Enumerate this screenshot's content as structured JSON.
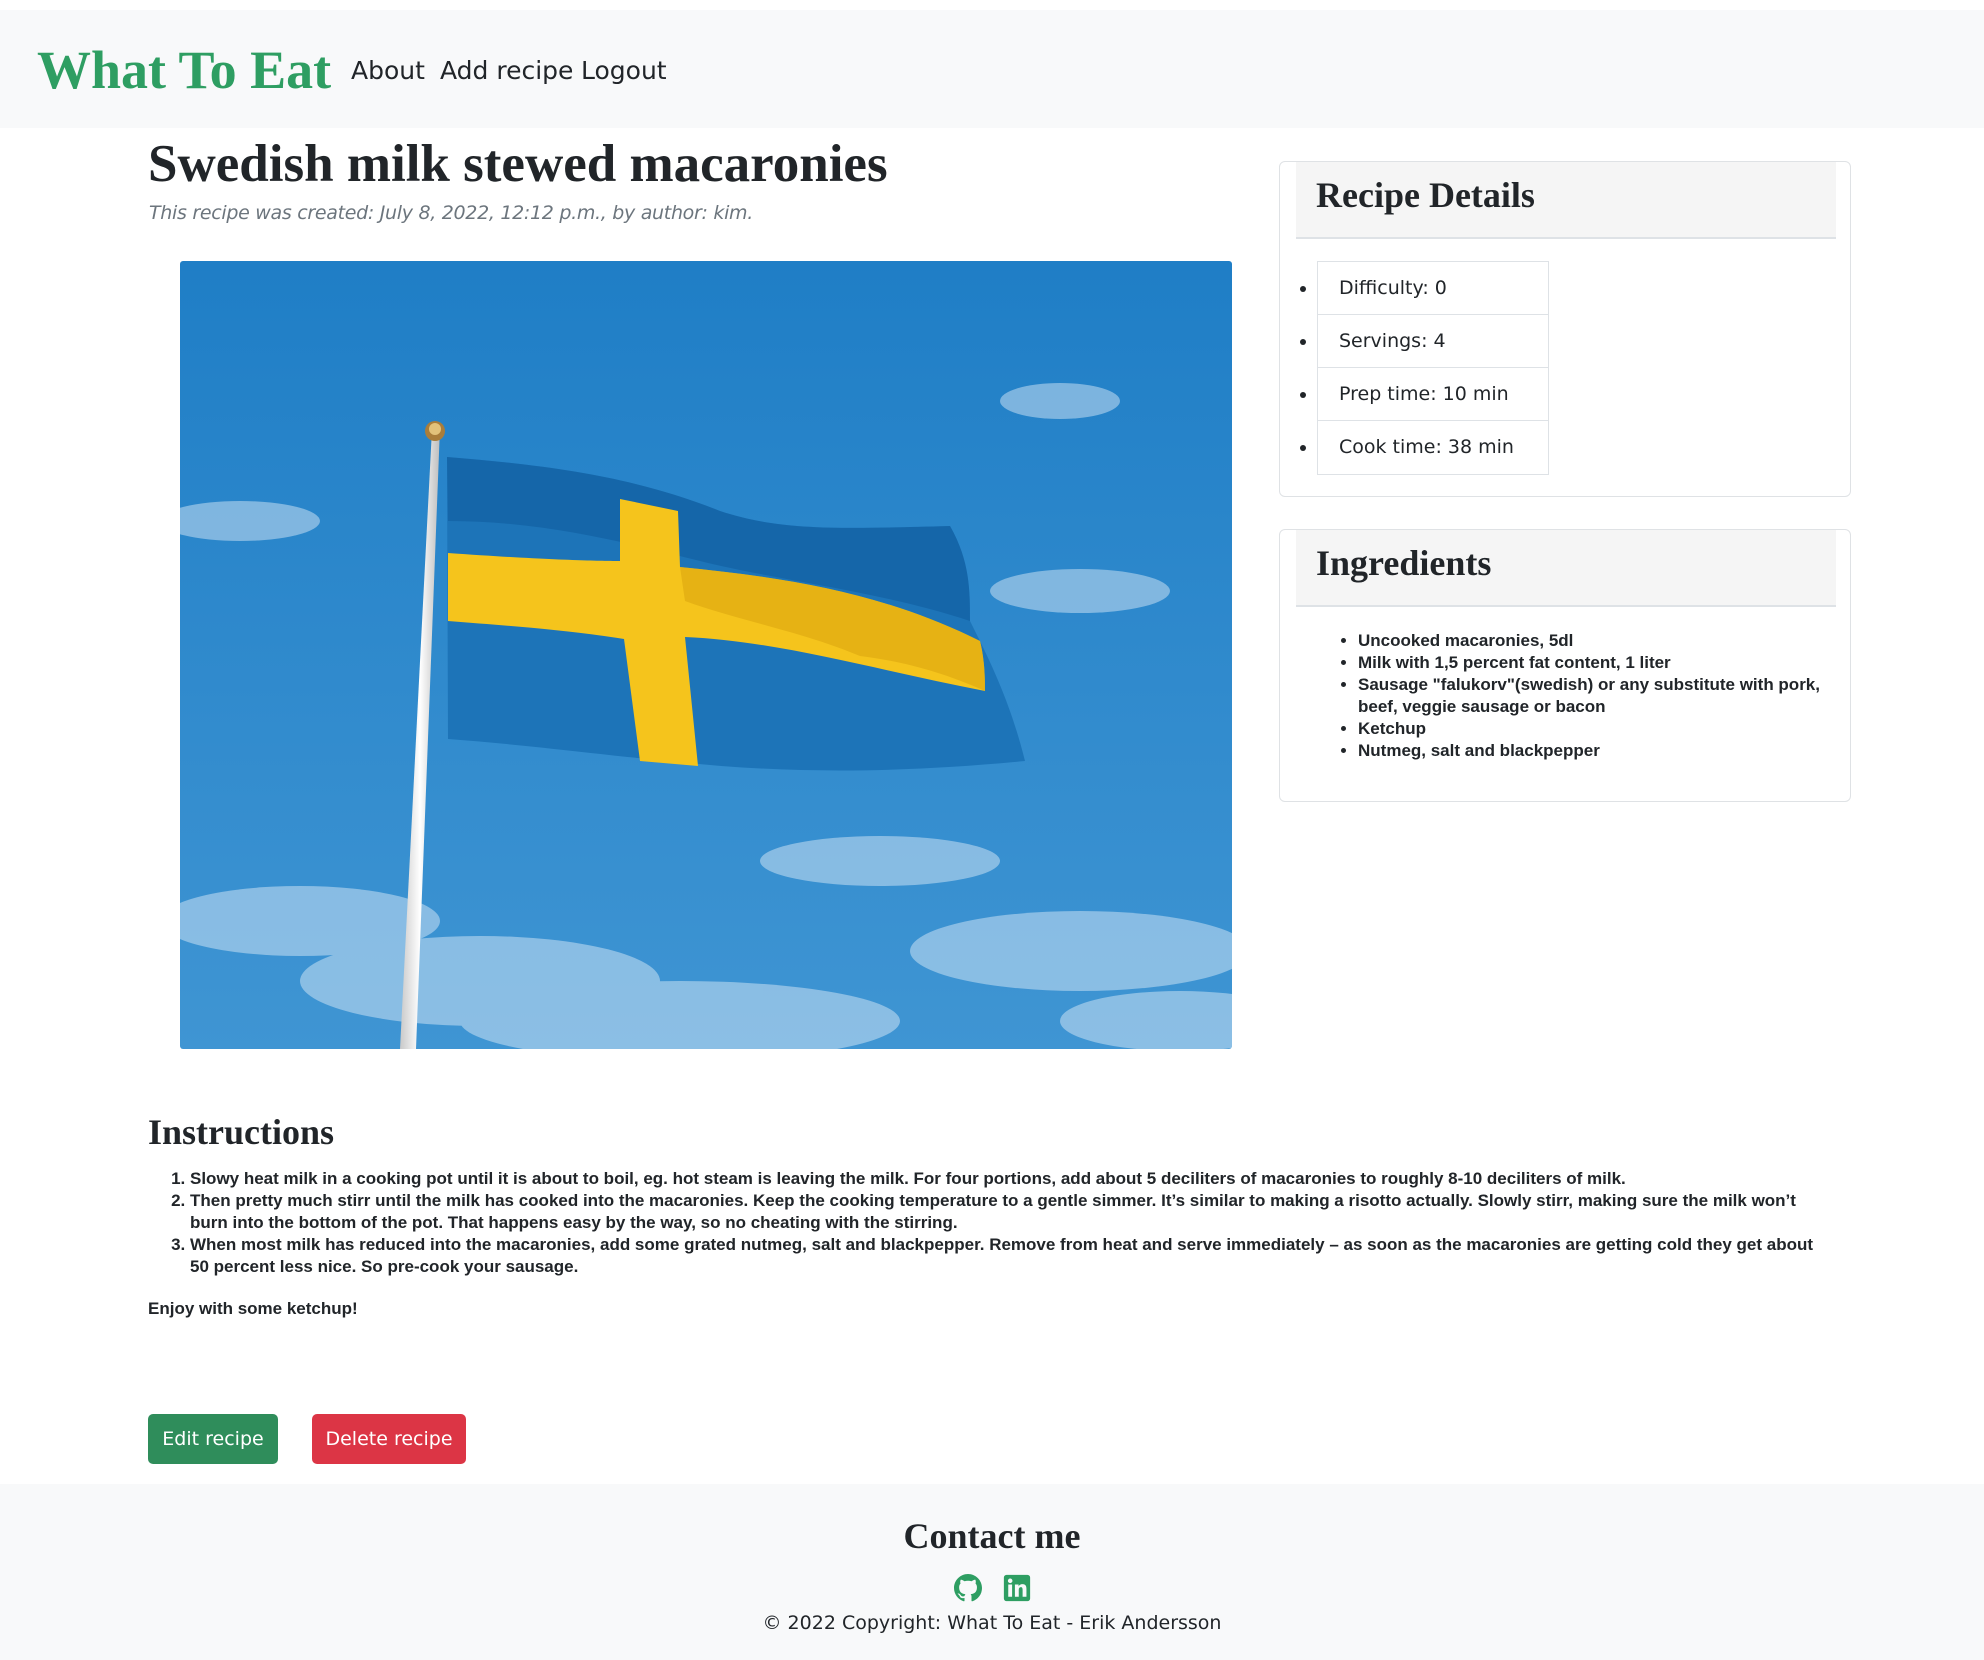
{
  "nav": {
    "brand": "What To Eat",
    "links": [
      "About",
      "Add recipe",
      "Logout"
    ]
  },
  "recipe": {
    "title": "Swedish milk stewed macaronies",
    "meta": "This recipe was created: July 8, 2022, 12:12 p.m., by author: kim."
  },
  "details": {
    "heading": "Recipe Details",
    "items": [
      "Difficulty: 0",
      "Servings: 4",
      "Prep time: 10 min",
      "Cook time: 38 min"
    ]
  },
  "ingredients": {
    "heading": "Ingredients",
    "items": [
      "Uncooked macaronies, 5dl",
      "Milk with 1,5 percent fat content, 1 liter",
      "Sausage \"falukorv\"(swedish) or any substitute with pork, beef, veggie sausage or bacon",
      "Ketchup",
      "Nutmeg, salt and blackpepper"
    ]
  },
  "instructions": {
    "heading": "Instructions",
    "steps": [
      "Slowy heat milk in a cooking pot until it is about to boil, eg. hot steam is leaving the milk. For four portions, add about 5 deciliters of macaronies to roughly 8-10 deciliters of milk.",
      "Then pretty much stirr until the milk has cooked into the macaronies. Keep the cooking temperature to a gentle simmer. It’s similar to making a risotto actually. Slowly stirr, making sure the milk won’t burn into the bottom of the pot. That happens easy by the way, so no cheating with the stirring.",
      "When most milk has reduced into the macaronies, add some grated nutmeg, salt and blackpepper. Remove from heat and serve immediately – as soon as the macaronies are getting cold they get about 50 percent less nice. So pre-cook your sausage."
    ],
    "closing": "Enjoy with some ketchup!"
  },
  "actions": {
    "edit": "Edit recipe",
    "delete": "Delete recipe"
  },
  "footer": {
    "heading": "Contact me",
    "icons": [
      "github-icon",
      "linkedin-icon"
    ],
    "copyright": "© 2022 Copyright: What To Eat - Erik Andersson"
  },
  "colors": {
    "brand": "#2e9e62",
    "edit_button": "#2f8d5b",
    "delete_button": "#dc3545",
    "nav_background": "#f8f9fa",
    "meta_text": "#6c757d"
  }
}
